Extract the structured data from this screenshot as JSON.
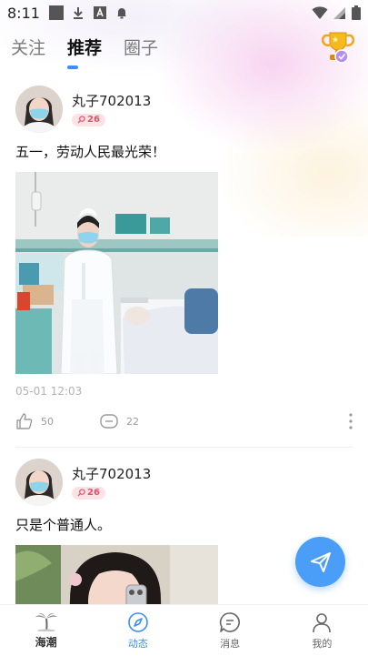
{
  "status_bar": {
    "time": "8:11"
  },
  "header": {
    "tabs": [
      {
        "label": "关注"
      },
      {
        "label": "推荐"
      },
      {
        "label": "圈子"
      }
    ],
    "active_tab": "推荐"
  },
  "posts": [
    {
      "username": "丸子702013",
      "level": "26",
      "text": "五一，劳动人民最光荣！",
      "time": "05-01 12:03",
      "likes": "50",
      "comments": "22"
    },
    {
      "username": "丸子702013",
      "level": "26",
      "text": "只是个普通人。"
    }
  ],
  "bottom_nav": {
    "items": [
      {
        "label": "海潮"
      },
      {
        "label": "动态"
      },
      {
        "label": "消息"
      },
      {
        "label": "我的"
      }
    ],
    "active": "动态"
  },
  "colors": {
    "accent": "#3b8ff5",
    "fab": "#4a9ef7",
    "badge_bg": "#ffe2e6",
    "badge_text": "#e5506a"
  },
  "icons": [
    "wifi-icon",
    "signal-icon",
    "battery-icon",
    "trophy-icon",
    "like-icon",
    "comment-icon",
    "more-icon",
    "send-icon",
    "palm-tree-icon",
    "compass-icon",
    "message-icon",
    "profile-icon"
  ]
}
